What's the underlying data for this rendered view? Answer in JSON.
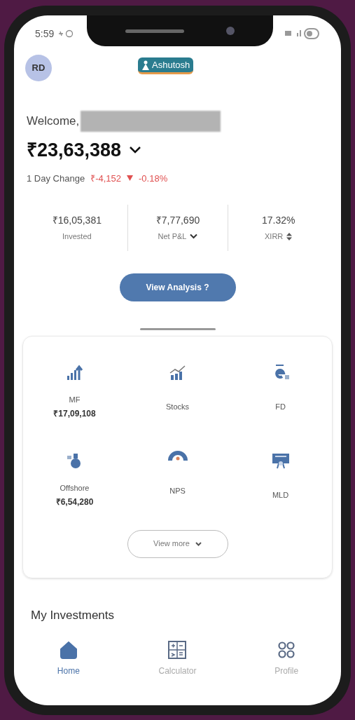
{
  "status_bar": {
    "time": "5:59"
  },
  "header": {
    "avatar": "RD",
    "logo": "Ashutosh"
  },
  "portfolio": {
    "welcome": "Welcome,",
    "total": "₹23,63,388",
    "day_change_label": "1 Day Change",
    "day_change_value": "₹-4,152",
    "day_change_pct": "-0.18%",
    "stats": [
      {
        "value": "₹16,05,381",
        "label": "Invested"
      },
      {
        "value": "₹7,77,690",
        "label": "Net P&L",
        "kind": "dropdown"
      },
      {
        "value": "17.32%",
        "label": "XIRR",
        "kind": "sort"
      }
    ],
    "analysis_button": "View Analysis ?"
  },
  "assets": [
    {
      "kind": "mf",
      "label": "MF",
      "amount": "₹17,09,108"
    },
    {
      "kind": "stocks",
      "label": "Stocks"
    },
    {
      "kind": "fd",
      "label": "FD"
    },
    {
      "kind": "offshore",
      "label": "Offshore",
      "amount": "₹6,54,280"
    },
    {
      "kind": "nps",
      "label": "NPS"
    },
    {
      "kind": "mld",
      "label": "MLD"
    }
  ],
  "view_more": "View more",
  "section_title": "My Investments",
  "nav": [
    {
      "kind": "home",
      "label": "Home",
      "selected": true
    },
    {
      "kind": "calculator",
      "label": "Calculator",
      "selected": false
    },
    {
      "kind": "profile",
      "label": "Profile",
      "selected": false
    }
  ]
}
